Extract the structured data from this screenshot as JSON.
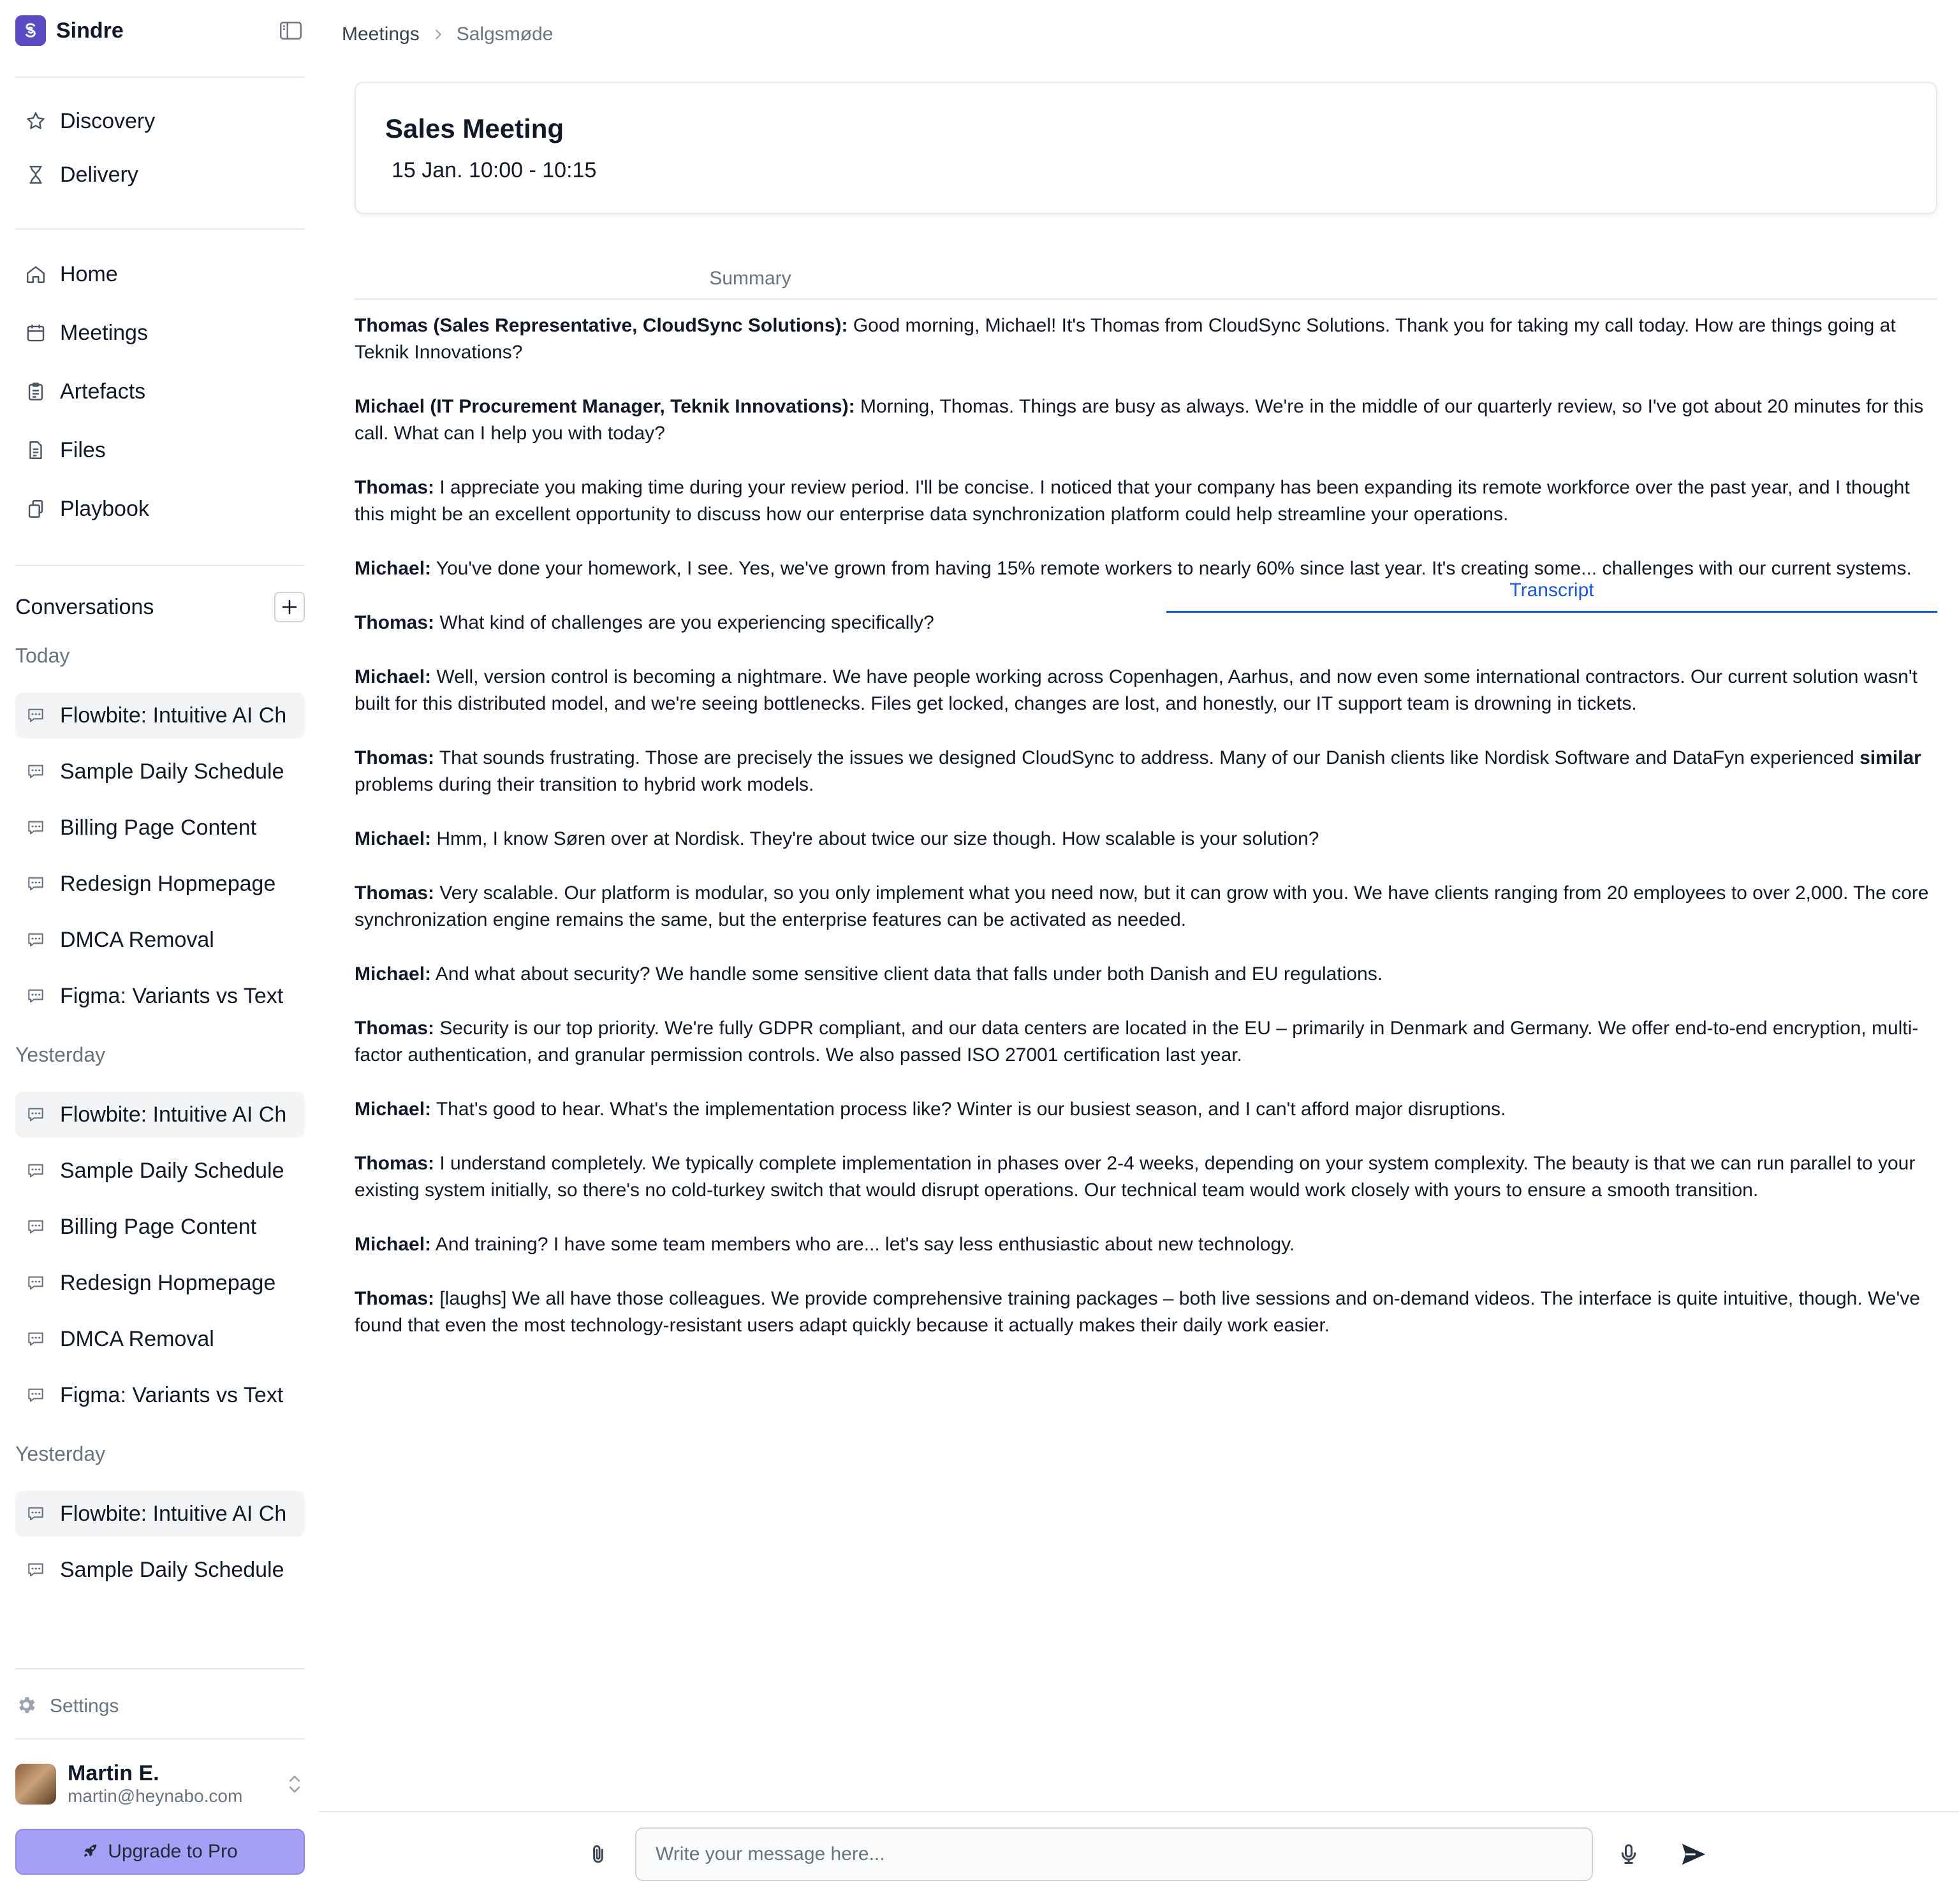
{
  "brand": {
    "name": "Sindre",
    "logo_icon": "sindre-logo-icon",
    "logo_color": "#5b4bc4"
  },
  "nav_top": [
    {
      "label": "Discovery",
      "icon": "star-icon"
    },
    {
      "label": "Delivery",
      "icon": "hourglass-icon"
    }
  ],
  "nav_main": [
    {
      "label": "Home",
      "icon": "home-icon"
    },
    {
      "label": "Meetings",
      "icon": "calendar-icon"
    },
    {
      "label": "Artefacts",
      "icon": "clipboard-icon"
    },
    {
      "label": "Files",
      "icon": "file-icon"
    },
    {
      "label": "Playbook",
      "icon": "copy-icon"
    }
  ],
  "conversations": {
    "title": "Conversations",
    "groups": [
      {
        "label": "Today",
        "items": [
          "Flowbite: Intuitive AI Ch",
          "Sample Daily Schedule",
          "Billing Page Content",
          "Redesign Hopmepage",
          "DMCA Removal",
          "Figma: Variants vs Text"
        ]
      },
      {
        "label": "Yesterday",
        "items": [
          "Flowbite: Intuitive AI Ch",
          "Sample Daily Schedule",
          "Billing Page Content",
          "Redesign Hopmepage",
          "DMCA Removal",
          "Figma: Variants vs Text"
        ]
      },
      {
        "label": "Yesterday",
        "items": [
          "Flowbite: Intuitive AI Ch",
          "Sample Daily Schedule"
        ]
      }
    ]
  },
  "settings_label": "Settings",
  "user": {
    "name": "Martin E.",
    "email": "martin@heynabo.com"
  },
  "upgrade_label": "Upgrade to Pro",
  "breadcrumb": {
    "parent": "Meetings",
    "current": "Salgsmøde"
  },
  "meeting": {
    "title": "Sales Meeting",
    "time": "15 Jan. 10:00 - 10:15"
  },
  "tabs": {
    "summary": "Summary",
    "transcript": "Transcript",
    "active": "Transcript",
    "accent": "#1a56db"
  },
  "transcript": [
    {
      "speaker": "Thomas (Sales Representative, CloudSync Solutions):",
      "text": " Good morning, Michael! It's Thomas from CloudSync Solutions. Thank you for taking my call today. How are things going at Teknik Innovations?"
    },
    {
      "speaker": "Michael (IT Procurement Manager, Teknik Innovations):",
      "text": " Morning, Thomas. Things are busy as always. We're in the middle of our quarterly review, so I've got about 20 minutes for this call. What can I help you with today?"
    },
    {
      "speaker": "Thomas:",
      "text": " I appreciate you making time during your review period. I'll be concise. I noticed that your company has been expanding its remote workforce over the past year, and I thought this might be an excellent opportunity to discuss how our enterprise data synchronization platform could help streamline your operations."
    },
    {
      "speaker": "Michael:",
      "text": " You've done your homework, I see. Yes, we've grown from having 15% remote workers to nearly 60% since last year. It's creating some... challenges with our current systems."
    },
    {
      "speaker": "Thomas:",
      "text": " What kind of challenges are you experiencing specifically?"
    },
    {
      "speaker": "Michael:",
      "text": " Well, version control is becoming a nightmare. We have people working across Copenhagen, Aarhus, and now even some international contractors. Our current solution wasn't built for this distributed model, and we're seeing bottlenecks. Files get locked, changes are lost, and honestly, our IT support team is drowning in tickets."
    },
    {
      "speaker": "Thomas:",
      "text": " That sounds frustrating. Those are precisely the issues we designed CloudSync to address. Many of our Danish clients like Nordisk Software and DataFyn experienced ",
      "bold": "similar",
      "tail": " problems during their transition to hybrid work models."
    },
    {
      "speaker": "Michael:",
      "text": " Hmm, I know Søren over at Nordisk. They're about twice our size though. How scalable is your solution?"
    },
    {
      "speaker": "Thomas:",
      "text": " Very scalable. Our platform is modular, so you only implement what you need now, but it can grow with you. We have clients ranging from 20 employees to over 2,000. The core synchronization engine remains the same, but the enterprise features can be activated as needed."
    },
    {
      "speaker": "Michael:",
      "text": " And what about security? We handle some sensitive client data that falls under both Danish and EU regulations."
    },
    {
      "speaker": "Thomas:",
      "text": " Security is our top priority. We're fully GDPR compliant, and our data centers are located in the EU – primarily in Denmark and Germany. We offer end-to-end encryption, multi-factor authentication, and granular permission controls. We also passed ISO 27001 certification last year."
    },
    {
      "speaker": "Michael:",
      "text": " That's good to hear. What's the implementation process like? Winter is our busiest season, and I can't afford major disruptions."
    },
    {
      "speaker": "Thomas:",
      "text": " I understand completely. We typically complete implementation in phases over 2-4 weeks, depending on your system complexity. The beauty is that we can run parallel to your existing system initially, so there's no cold-turkey switch that would disrupt operations. Our technical team would work closely with yours to ensure a smooth transition."
    },
    {
      "speaker": "Michael:",
      "text": " And training? I have some team members who are... let's say less enthusiastic about new technology."
    },
    {
      "speaker": "Thomas:",
      "text": " [laughs] We all have those colleagues. We provide comprehensive training packages – both live sessions and on-demand videos. The interface is quite intuitive, though. We've found that even the most technology-resistant users adapt quickly because it actually makes their daily work easier."
    }
  ],
  "composer": {
    "placeholder": "Write your message here..."
  }
}
